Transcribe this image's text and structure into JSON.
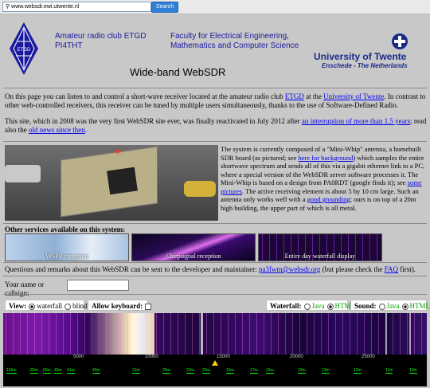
{
  "browser": {
    "url": "www.websdr.ewi.utwente.nl",
    "search_label": "Search"
  },
  "header": {
    "club_line1": "Amateur radio club ETGD",
    "club_line2": "PI4THT",
    "faculty_line1": "Faculty for Electrical Engineering,",
    "faculty_line2": "Mathematics and Computer Science",
    "title": "Wide-band WebSDR",
    "univ_name": "University of Twente",
    "univ_sub": "Enschede - The Netherlands",
    "logo_text": "ETGD"
  },
  "intro": {
    "t1": "On this page you can listen to and control a short-wave receiver located at the amateur radio club ",
    "link1": "ETGD",
    "t2": " at the ",
    "link2": "University of Twente",
    "t3": ". In contrast to other web-controlled receivers, this receiver can be tuned by multiple users simultaneously, thanks to the use of Software-Defined Radio."
  },
  "history": {
    "t1": "This site, which in 2008 was the very first WebSDR site ever, was finally reactivated in July 2012 after ",
    "link1": "an interruption of more than 1.5 years",
    "t2": "; read also the ",
    "link2": "old news since then",
    "t3": "."
  },
  "system": {
    "t1": "The system is currently composed of a \"Mini-Whip\" antenna, a homebuilt SDR board (as pictured; see ",
    "link1": "here for background",
    "t2": ") which samples the entire shortwave spectrum and sends all of this via a gigabit ethernet link to a PC, where a special version of the WebSDR server software processes it. The Mini-Whip is based on a design from PA0RDT (google finds it); see ",
    "link2": "some pictures",
    "t3": ". The active receiving element is about 5 by 10 cm large. Such an antenna only works well with a ",
    "link3": "good grounding",
    "t4": "; ours is on top of a 20m high building, the upper part of which is all metal."
  },
  "services": {
    "title": "Other services available on this system:",
    "items": [
      {
        "label": "WSPR reception"
      },
      {
        "label": "Chirpsignal reception"
      },
      {
        "label": "Entire day waterfall display"
      }
    ]
  },
  "contact": {
    "t1": "Questions and remarks about this WebSDR can be sent to the developer and maintainer: ",
    "email": "pa3fwm@websdr.org",
    "t2": " (but please check the ",
    "faq": "FAQ",
    "t3": " first)."
  },
  "callsign": {
    "label": "Your name or callsign:",
    "value": ""
  },
  "controls": {
    "view_label": "View:",
    "view_waterfall": "waterfall",
    "view_blind": "blind",
    "keyboard_label": "Allow keyboard:",
    "waterfall_label": "Waterfall:",
    "sound_label": "Sound:",
    "java": "Java",
    "html5": "HTML5"
  },
  "scale": {
    "ticks": [
      "5000",
      "10000",
      "15000",
      "20000",
      "25000"
    ],
    "bands": [
      "160m",
      "80m",
      "60m",
      "49m",
      "41m",
      "40m",
      "31m",
      "25m",
      "22m",
      "20m",
      "19m",
      "17m",
      "16m",
      "15m",
      "13m",
      "12m",
      "11m",
      "10m"
    ]
  }
}
